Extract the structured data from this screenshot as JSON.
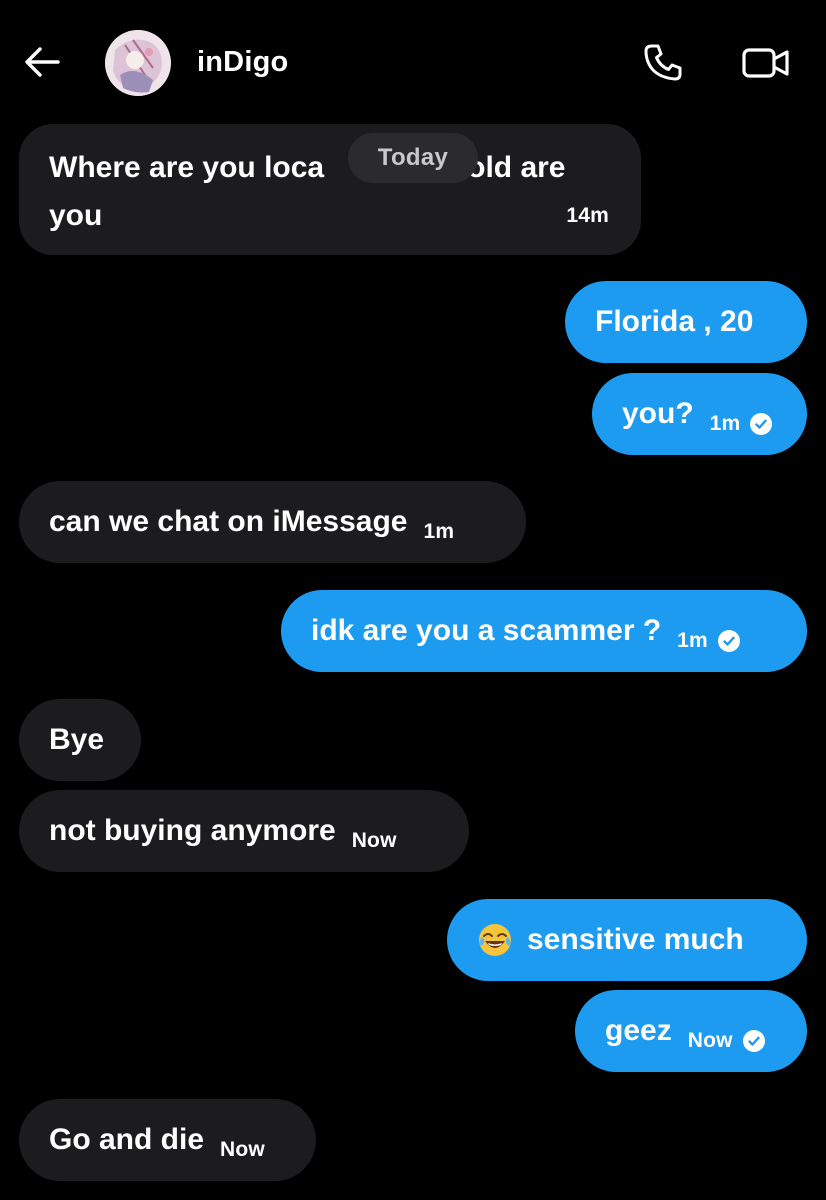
{
  "header": {
    "contact_name": "inDigo",
    "back_icon": "arrow-left-icon",
    "call_icon": "phone-icon",
    "video_icon": "video-camera-icon"
  },
  "colors": {
    "background": "#000000",
    "incoming_bubble": "#1c1c1e",
    "outgoing_bubble": "#1d9bf0",
    "date_pill": "#2b2b2e"
  },
  "date_divider": "Today",
  "messages": [
    {
      "direction": "incoming",
      "text": "Where are you loca",
      "text_after_pill": "v old are",
      "text_line2": "you",
      "time": "14m"
    },
    {
      "direction": "outgoing",
      "text": "Florida , 20",
      "time": ""
    },
    {
      "direction": "outgoing",
      "text": "you?",
      "time": "1m",
      "seen": true
    },
    {
      "direction": "incoming",
      "text": "can we chat on iMessage",
      "time": "1m"
    },
    {
      "direction": "outgoing",
      "text": "idk are you a scammer ?",
      "time": "1m",
      "seen": true
    },
    {
      "direction": "incoming",
      "text": "Bye",
      "time": ""
    },
    {
      "direction": "incoming",
      "text": "not buying anymore",
      "time": "Now"
    },
    {
      "direction": "outgoing",
      "text": "sensitive much",
      "emoji": "face-with-tears-of-joy-icon",
      "time": ""
    },
    {
      "direction": "outgoing",
      "text": "geez",
      "time": "Now",
      "seen": true
    },
    {
      "direction": "incoming",
      "text": "Go and die",
      "time": "Now"
    }
  ]
}
